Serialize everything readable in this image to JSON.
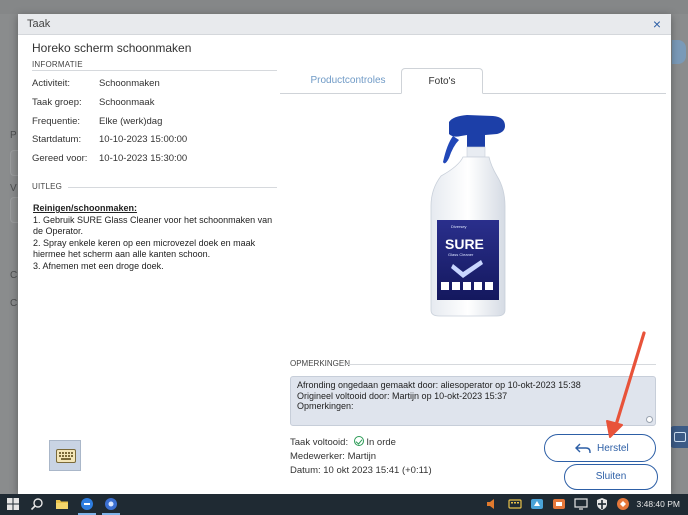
{
  "background": {
    "letters": [
      "P",
      "V",
      "C",
      "C"
    ]
  },
  "dialog": {
    "title": "Taak",
    "close_glyph": "×",
    "task_title": "Horeko scherm schoonmaken",
    "info_section": "INFORMATIE",
    "info": [
      {
        "key": "Activiteit:",
        "value": "Schoonmaken"
      },
      {
        "key": "Taak groep:",
        "value": "Schoonmaak"
      },
      {
        "key": "Frequentie:",
        "value": "Elke (werk)dag"
      },
      {
        "key": "Startdatum:",
        "value": "10-10-2023 15:00:00"
      },
      {
        "key": "Gereed voor:",
        "value": "10-10-2023 15:30:00"
      }
    ],
    "uitleg_section": "UITLEG",
    "uitleg_heading": "Reinigen/schoonmaken:",
    "uitleg_lines": [
      "1. Gebruik SURE Glass Cleaner voor het schoonmaken van",
      "de Operator.",
      "2. Spray enkele keren op een microvezel doek en maak",
      "hiermee het scherm aan alle kanten schoon.",
      "3. Afnemen met een droge doek."
    ],
    "tabs": [
      {
        "label": "Productcontroles",
        "active": false
      },
      {
        "label": "Foto's",
        "active": true
      }
    ],
    "product_label": {
      "brand": "Diversey",
      "name": "SURE",
      "sub": "Glass Cleaner"
    },
    "remarks_section": "OPMERKINGEN",
    "remarks_lines": [
      "Afronding ongedaan gemaakt door: aliesoperator op 10-okt-2023 15:38",
      "Origineel voltooid door: Martijn op 10-okt-2023 15:37",
      "Opmerkingen:"
    ],
    "status": {
      "completed_label": "Taak voltooid:",
      "completed_value": "In orde",
      "employee_label": "Medewerker:",
      "employee_value": "Martijn",
      "date_label": "Datum:",
      "date_value": "10 okt 2023 15:41 (+0:11)"
    },
    "buttons": {
      "restore": "Herstel",
      "close": "Sluiten"
    }
  },
  "taskbar": {
    "clock": "3:48:40 PM"
  },
  "colors": {
    "accent": "#2d5fa6",
    "annotation_arrow": "#e8533a",
    "remarks_bg": "#dfe4ed",
    "taskbar": "#1f2a33"
  }
}
